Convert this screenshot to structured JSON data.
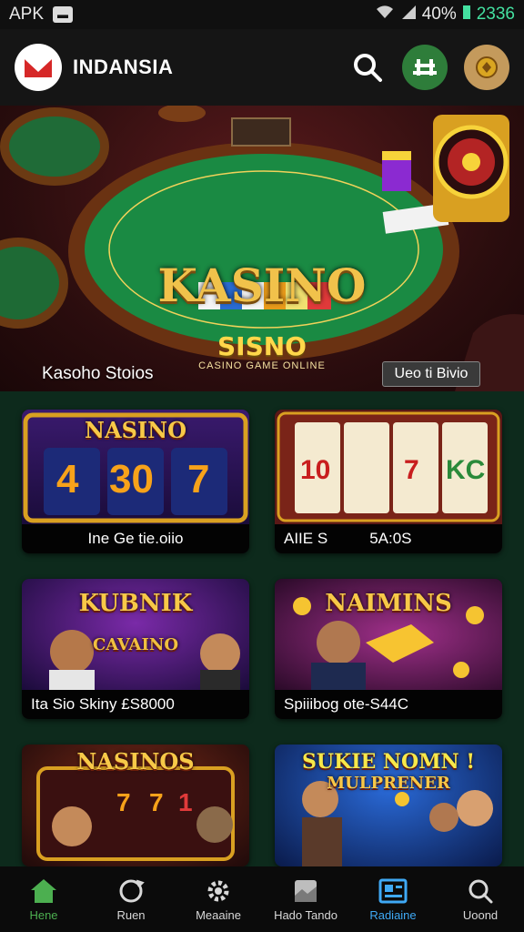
{
  "status_bar": {
    "carrier": "APK",
    "battery": "40%",
    "time": "2336"
  },
  "header": {
    "app_name": "INDANSIA"
  },
  "hero": {
    "title": "KASINO",
    "subtitle": "SISNO",
    "tagline": "CASINO GAME ONLINE",
    "caption": "Kasoho Stoios",
    "button_label": "Ueo ti Bivio"
  },
  "games": [
    {
      "art_title": "NASINO",
      "reels": [
        "4",
        "30",
        "7"
      ],
      "meta_left": "Ine Ge tie.oiio",
      "meta_right": ""
    },
    {
      "art_title": "",
      "reels": [
        "10",
        "7",
        "KC"
      ],
      "meta_left": "AIIE S",
      "meta_right": "5A:0S"
    },
    {
      "art_title": "KUBNIK",
      "sub": "CAVAINO",
      "meta_left": "Ita Sio Skiny £S8000",
      "meta_right": ""
    },
    {
      "art_title": "NAIMINS",
      "meta_left": "Spiiibog ote-S44C",
      "meta_right": ""
    },
    {
      "art_title": "NASINOS",
      "reels": [
        "7",
        "7",
        "1"
      ],
      "meta_left": "",
      "meta_right": ""
    },
    {
      "art_title": "SUKIE NOMN !",
      "sub": "MULPRENER",
      "meta_left": "",
      "meta_right": ""
    }
  ],
  "bottom_nav": [
    {
      "label": "Hene",
      "icon": "home-icon"
    },
    {
      "label": "Ruen",
      "icon": "refresh-icon"
    },
    {
      "label": "Meaaine",
      "icon": "gear-icon"
    },
    {
      "label": "Hado Tando",
      "icon": "card-icon"
    },
    {
      "label": "Radiaine",
      "icon": "news-icon"
    },
    {
      "label": "Uoond",
      "icon": "search-icon"
    }
  ],
  "colors": {
    "background": "#0d2a1c",
    "active_nav": "#4caf50",
    "selected_nav": "#3fa9f5",
    "gold": "#f1c24b"
  }
}
